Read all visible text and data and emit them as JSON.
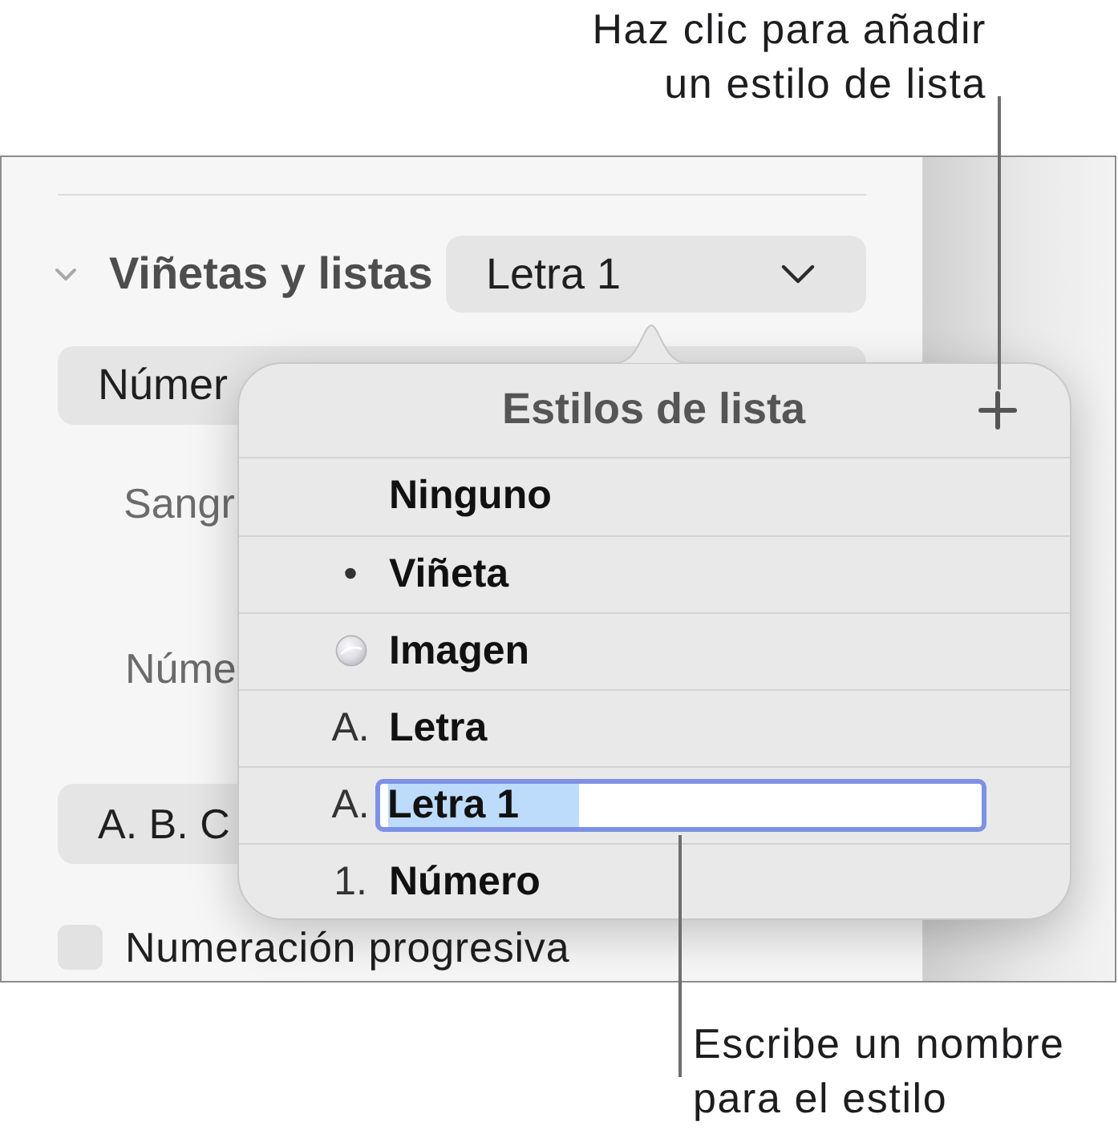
{
  "callout_top": {
    "lines": [
      "Haz clic para añadir",
      "un estilo de lista"
    ]
  },
  "inspector": {
    "section": {
      "title": "Viñetas y listas",
      "expanded": true,
      "style_popup": "Letra 1"
    },
    "type_popup": "Númer",
    "indent_label": "Sangr",
    "number_label": "Núme",
    "format_popup": "A. B. C",
    "progressive": {
      "label": "Numeración progresiva",
      "checked": false
    }
  },
  "popover": {
    "title": "Estilos de lista",
    "styles": [
      {
        "kind": "none",
        "name": "Ninguno",
        "editing": false
      },
      {
        "kind": "text",
        "marker": "•",
        "name": "Viñeta",
        "editing": false
      },
      {
        "kind": "image",
        "name": "Imagen",
        "editing": false
      },
      {
        "kind": "text",
        "marker": "A.",
        "name": "Letra",
        "editing": false
      },
      {
        "kind": "text",
        "marker": "A.",
        "name": "Letra 1",
        "editing": true
      },
      {
        "kind": "text",
        "marker": "1.",
        "name": "Número",
        "editing": false
      }
    ]
  },
  "callout_bottom": {
    "lines": [
      "Escribe un nombre",
      "para el estilo"
    ]
  }
}
